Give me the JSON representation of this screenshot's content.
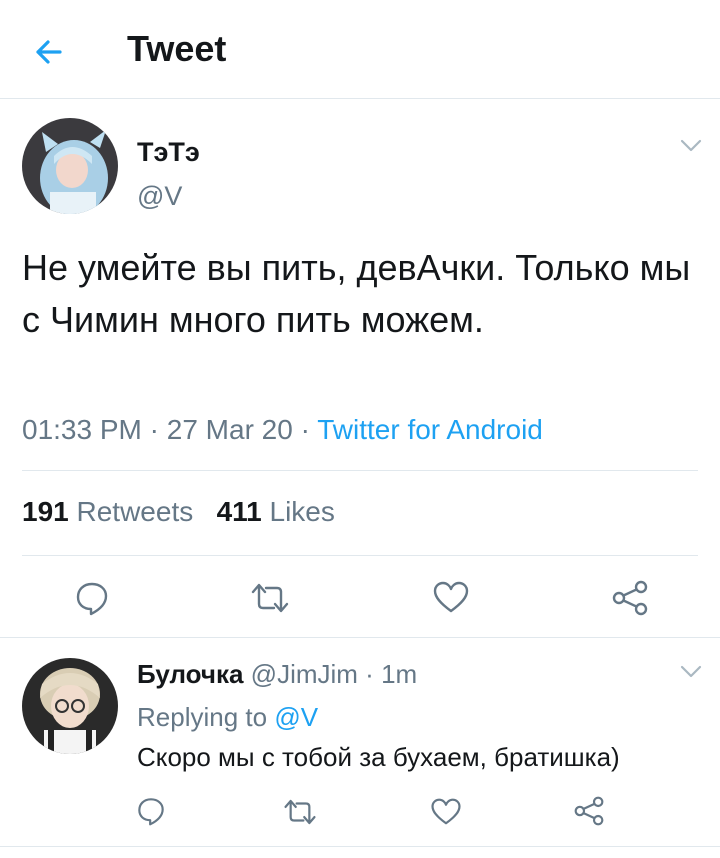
{
  "header": {
    "title": "Tweet",
    "back_icon": "back-arrow-icon",
    "accent": "#1da1f2"
  },
  "tweet": {
    "author_name": "ТэТэ",
    "author_handle": "@V",
    "text": "Не умейте вы пить, девАчки. Только мы с Чимин много пить можем.",
    "time": "01:33 PM",
    "date": "27 Mar 20",
    "source": "Twitter for Android",
    "retweets_count": "191",
    "retweets_label": "Retweets",
    "likes_count": "411",
    "likes_label": "Likes"
  },
  "reply": {
    "author_name": "Булочка",
    "author_handle": "@JimJim",
    "time": "1m",
    "replying_to_label": "Replying to",
    "replying_to_handle": "@V",
    "text": "Скоро мы с тобой за бухаем, братишка)"
  },
  "separator": "·",
  "colors": {
    "text": "#14171a",
    "secondary": "#657786",
    "link": "#1da1f2",
    "border": "#e1e8ed"
  }
}
